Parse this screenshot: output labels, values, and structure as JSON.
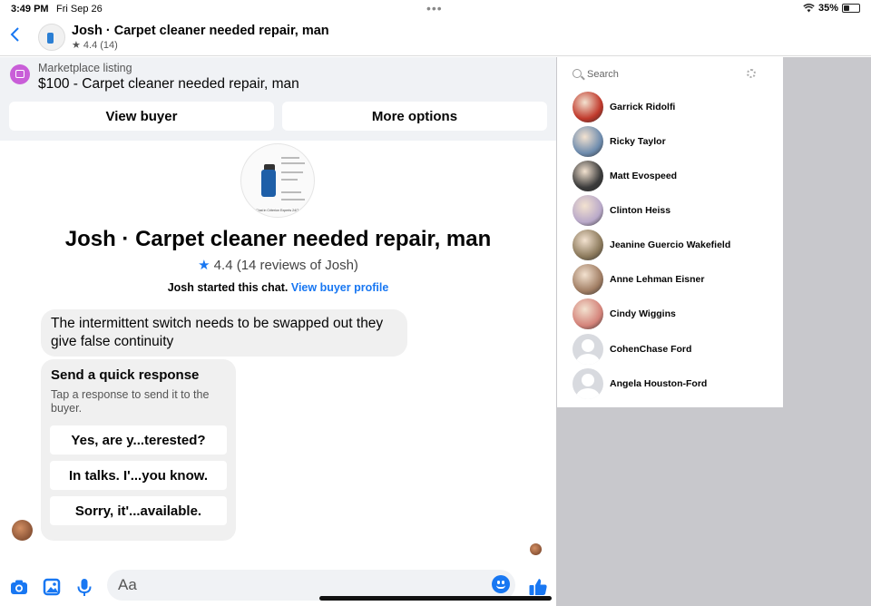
{
  "status": {
    "time": "3:49 PM",
    "date": "Fri Sep 26",
    "dots": "•••",
    "battery": "35%",
    "battery_level": 0.35
  },
  "header": {
    "title": "Josh · Carpet cleaner needed repair, man",
    "rating": "★ 4.4 (14)"
  },
  "listing": {
    "label": "Marketplace listing",
    "title": "$100 - Carpet cleaner needed repair, man",
    "view_buyer": "View buyer",
    "more_options": "More options"
  },
  "chat": {
    "title": "Josh · Carpet cleaner needed repair, man",
    "rating_star": "★",
    "rating": " 4.4 (14 reviews of Josh)",
    "started": "Josh started this chat. ",
    "profile_link": "View buyer profile",
    "message": "The intermittent switch needs to be swapped out they give false continuity",
    "thumb_caption": "Chat in Criterion Experts 24/7"
  },
  "quick_response": {
    "title": "Send a quick response",
    "subtitle": "Tap a response to send it to the buyer.",
    "options": [
      "Yes, are y...terested?",
      "In talks. I'...you know.",
      "Sorry, it'...available."
    ]
  },
  "composer": {
    "placeholder": "Aa"
  },
  "contacts": {
    "search_placeholder": "Search",
    "list": [
      {
        "name": "Garrick Ridolfi",
        "color": "#c0392b"
      },
      {
        "name": "Ricky Taylor",
        "color": "#6e8cae"
      },
      {
        "name": "Matt Evospeed",
        "color": "#3a3a3a"
      },
      {
        "name": "Clinton Heiss",
        "color": "#b9a9c9"
      },
      {
        "name": "Jeanine Guercio Wakefield",
        "color": "#8c7a5c"
      },
      {
        "name": "Anne Lehman Eisner",
        "color": "#a17e64"
      },
      {
        "name": "Cindy Wiggins",
        "color": "#d4837a"
      },
      {
        "name": "CohenChase Ford",
        "color": ""
      },
      {
        "name": "Angela Houston-Ford",
        "color": ""
      }
    ]
  },
  "colors": {
    "accent": "#1877f2",
    "listing_icon": "#c95ed8"
  }
}
